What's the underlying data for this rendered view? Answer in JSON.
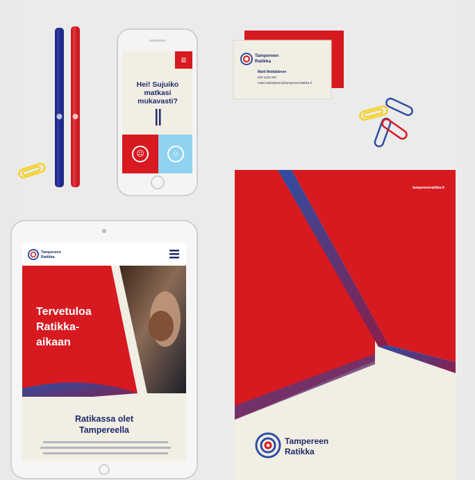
{
  "colors": {
    "brand_red": "#d71920",
    "brand_navy": "#1f2a6b",
    "brand_blue": "#2e4ea2",
    "cream": "#f1eee3",
    "sky": "#8fd3f0",
    "clip_yellow": "#f3d12a",
    "background": "#e9e9ea"
  },
  "brand": {
    "name_line1": "Tampereen",
    "name_line2": "Ratikka",
    "logo_icon": "tram-rings-logo-icon",
    "website": "tampereenratikka.fi"
  },
  "phone": {
    "question": "Hei! Sujuiko matkasi mukavasti?",
    "menu_icon": "menu-icon",
    "sad_icon": "sad-face-icon",
    "happy_icon": "happy-face-icon"
  },
  "card": {
    "contact_name": "Matti Meikäläinen",
    "phone": "040 1234 567",
    "email": "matti.meikalainen@tampereenratikka.fi"
  },
  "tablet": {
    "hero_title_line1": "Tervetuloa",
    "hero_title_line2": "Ratikka-",
    "hero_title_line3": "aikaan",
    "subtitle_line1": "Ratikassa olet",
    "subtitle_line2": "Tampereella",
    "menu_icon": "hamburger-menu-icon"
  }
}
